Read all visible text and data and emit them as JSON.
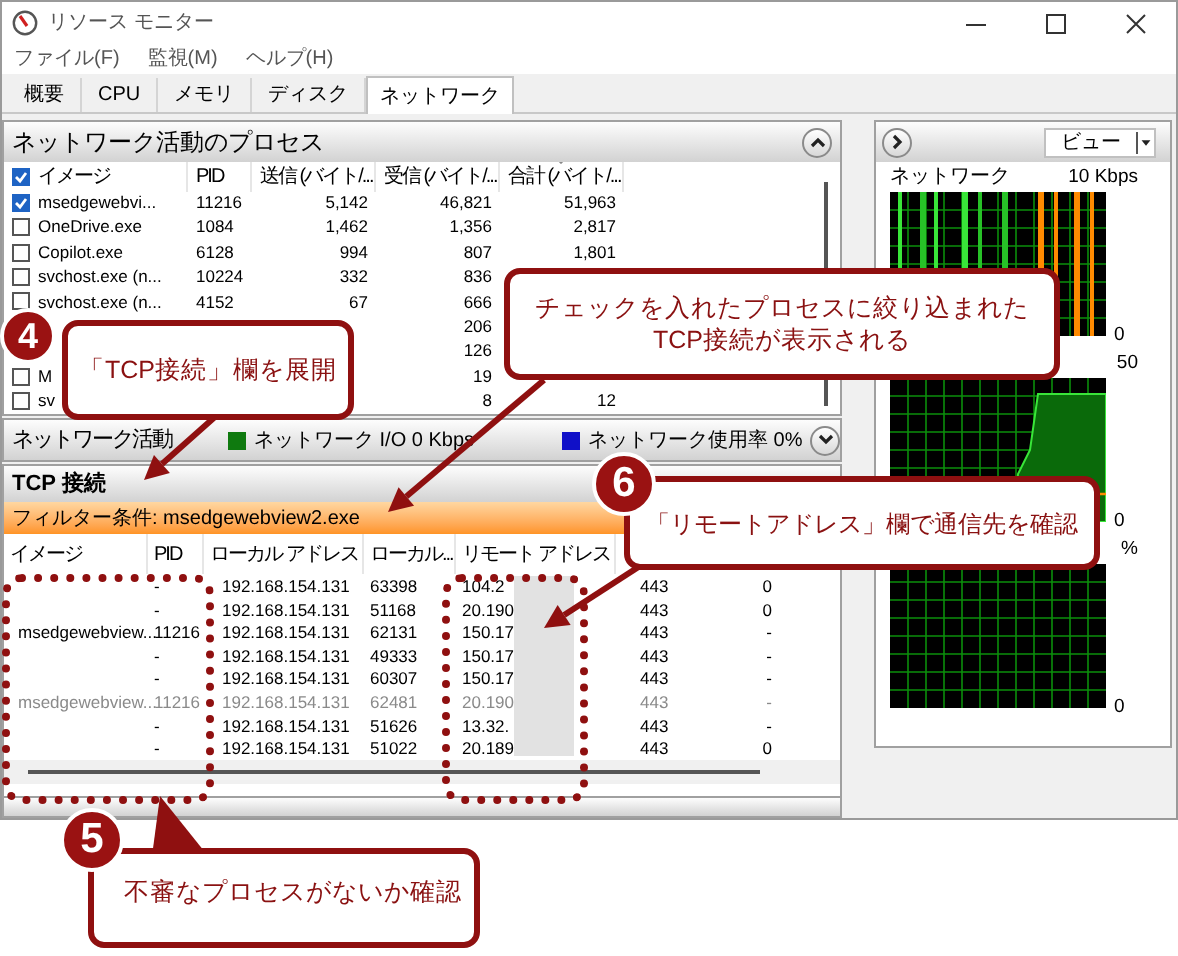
{
  "window": {
    "title": "リソース モニター"
  },
  "menu": [
    "ファイル(F)",
    "監視(M)",
    "ヘルプ(H)"
  ],
  "tabs": [
    {
      "label": "概要",
      "selected": false
    },
    {
      "label": "CPU",
      "selected": false
    },
    {
      "label": "メモリ",
      "selected": false
    },
    {
      "label": "ディスク",
      "selected": false
    },
    {
      "label": "ネットワーク",
      "selected": true
    }
  ],
  "processes": {
    "title": "ネットワーク活動のプロセス",
    "expanded": true,
    "all_checked": true,
    "columns": [
      "イメージ",
      "PID",
      "送信 (バイト/...",
      "受信 (バイト/...",
      "合計 (バイト/..."
    ],
    "rows": [
      {
        "checked": true,
        "image": "msedgewebvi...",
        "pid": "11216",
        "sent": "5,142",
        "received": "46,821",
        "total": "51,963"
      },
      {
        "checked": false,
        "image": "OneDrive.exe",
        "pid": "1084",
        "sent": "1,462",
        "received": "1,356",
        "total": "2,817"
      },
      {
        "checked": false,
        "image": "Copilot.exe",
        "pid": "6128",
        "sent": "994",
        "received": "807",
        "total": "1,801"
      },
      {
        "checked": false,
        "image": "svchost.exe (n...",
        "pid": "10224",
        "sent": "332",
        "received": "836"
      },
      {
        "checked": false,
        "image": "svchost.exe (n...",
        "pid": "4152",
        "sent": "67",
        "received": "666"
      },
      {
        "received": "206"
      },
      {
        "received": "126"
      },
      {
        "checked": false,
        "image": "M",
        "received": "19"
      },
      {
        "checked": false,
        "image": "sv",
        "received": "8",
        "total": "12"
      }
    ]
  },
  "network_activity": {
    "title": "ネットワーク活動",
    "expanded": false,
    "legend": [
      {
        "label": "ネットワーク I/O 0 Kbps",
        "color": "#0f7a0f"
      },
      {
        "label": "ネットワーク使用率 0%",
        "color": "#1010c8"
      }
    ]
  },
  "tcp": {
    "title": "TCP 接続",
    "filter": "フィルター条件: msedgewebview2.exe",
    "columns": [
      "イメージ",
      "PID",
      "ローカル アドレス",
      "ローカル...",
      "リモート アドレス"
    ],
    "rows": [
      {
        "pid": "-",
        "local_address": "192.168.154.131",
        "local_port": "63398",
        "remote_address": "104.2",
        "remote_port": "443",
        "column_7": "0",
        "greyed": false
      },
      {
        "pid": "-",
        "local_address": "192.168.154.131",
        "local_port": "51168",
        "remote_address": "20.190",
        "remote_port": "443",
        "column_7": "0",
        "greyed": false
      },
      {
        "image": "msedgewebview...",
        "pid": "11216",
        "local_address": "192.168.154.131",
        "local_port": "62131",
        "remote_address": "150.17",
        "remote_port": "443",
        "column_7": "-",
        "greyed": false
      },
      {
        "pid": "-",
        "local_address": "192.168.154.131",
        "local_port": "49333",
        "remote_address": "150.17",
        "remote_port": "443",
        "column_7": "-",
        "greyed": false
      },
      {
        "pid": "-",
        "local_address": "192.168.154.131",
        "local_port": "60307",
        "remote_address": "150.17",
        "remote_port": "443",
        "column_7": "-",
        "greyed": false
      },
      {
        "image": "msedgewebview...",
        "pid": "11216",
        "local_address": "192.168.154.131",
        "local_port": "62481",
        "remote_address": "20.190",
        "remote_port": "443",
        "column_7": "-",
        "greyed": true
      },
      {
        "pid": "-",
        "local_address": "192.168.154.131",
        "local_port": "51626",
        "remote_address": "13.32.",
        "remote_port": "443",
        "column_7": "-",
        "greyed": false
      },
      {
        "pid": "-",
        "local_address": "192.168.154.131",
        "local_port": "51022",
        "remote_address": "20.189",
        "remote_port": "443",
        "column_7": "0",
        "greyed": false
      }
    ]
  },
  "monitor": {
    "view": "ビュー",
    "graphs": [
      {
        "title": "ネットワーク",
        "max": "10 Kbps",
        "min": "0"
      },
      {
        "max": "50",
        "min": "0"
      },
      {
        "max": "%",
        "min": "0"
      }
    ]
  },
  "callouts": [
    {
      "number": "4",
      "lines": [
        "「TCP接続」欄を展開"
      ]
    },
    {
      "lines": [
        "チェックを入れたプロセスに絞り込まれた",
        "TCP接続が表示される"
      ]
    },
    {
      "number": "6",
      "lines": [
        "「リモートアドレス」欄で通信先を確認"
      ]
    },
    {
      "number": "5",
      "lines": [
        "不審なプロセスがないか確認"
      ]
    }
  ]
}
